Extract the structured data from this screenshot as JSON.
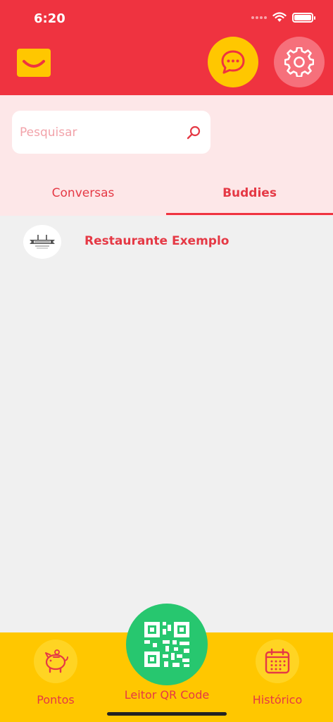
{
  "status_bar": {
    "time": "6:20"
  },
  "header": {
    "logo_icon": "smile-logo",
    "chat_icon": "chat-bubble-icon",
    "settings_icon": "gear-icon"
  },
  "search": {
    "placeholder": "Pesquisar",
    "value": ""
  },
  "tabs": [
    {
      "label": "Conversas",
      "active": false
    },
    {
      "label": "Buddies",
      "active": true
    }
  ],
  "list": [
    {
      "name": "Restaurante Exemplo",
      "avatar_icon": "restaurant-logo"
    }
  ],
  "bottom_nav": {
    "pontos": {
      "label": "Pontos",
      "icon": "piggy-bank-icon"
    },
    "qr": {
      "label": "Leitor QR Code",
      "icon": "qr-code-icon"
    },
    "historico": {
      "label": "Histórico",
      "icon": "calendar-icon"
    }
  },
  "colors": {
    "primary_red": "#ef3340",
    "yellow": "#ffc700",
    "green": "#27c76f",
    "pink_bg": "#fde7e8"
  }
}
